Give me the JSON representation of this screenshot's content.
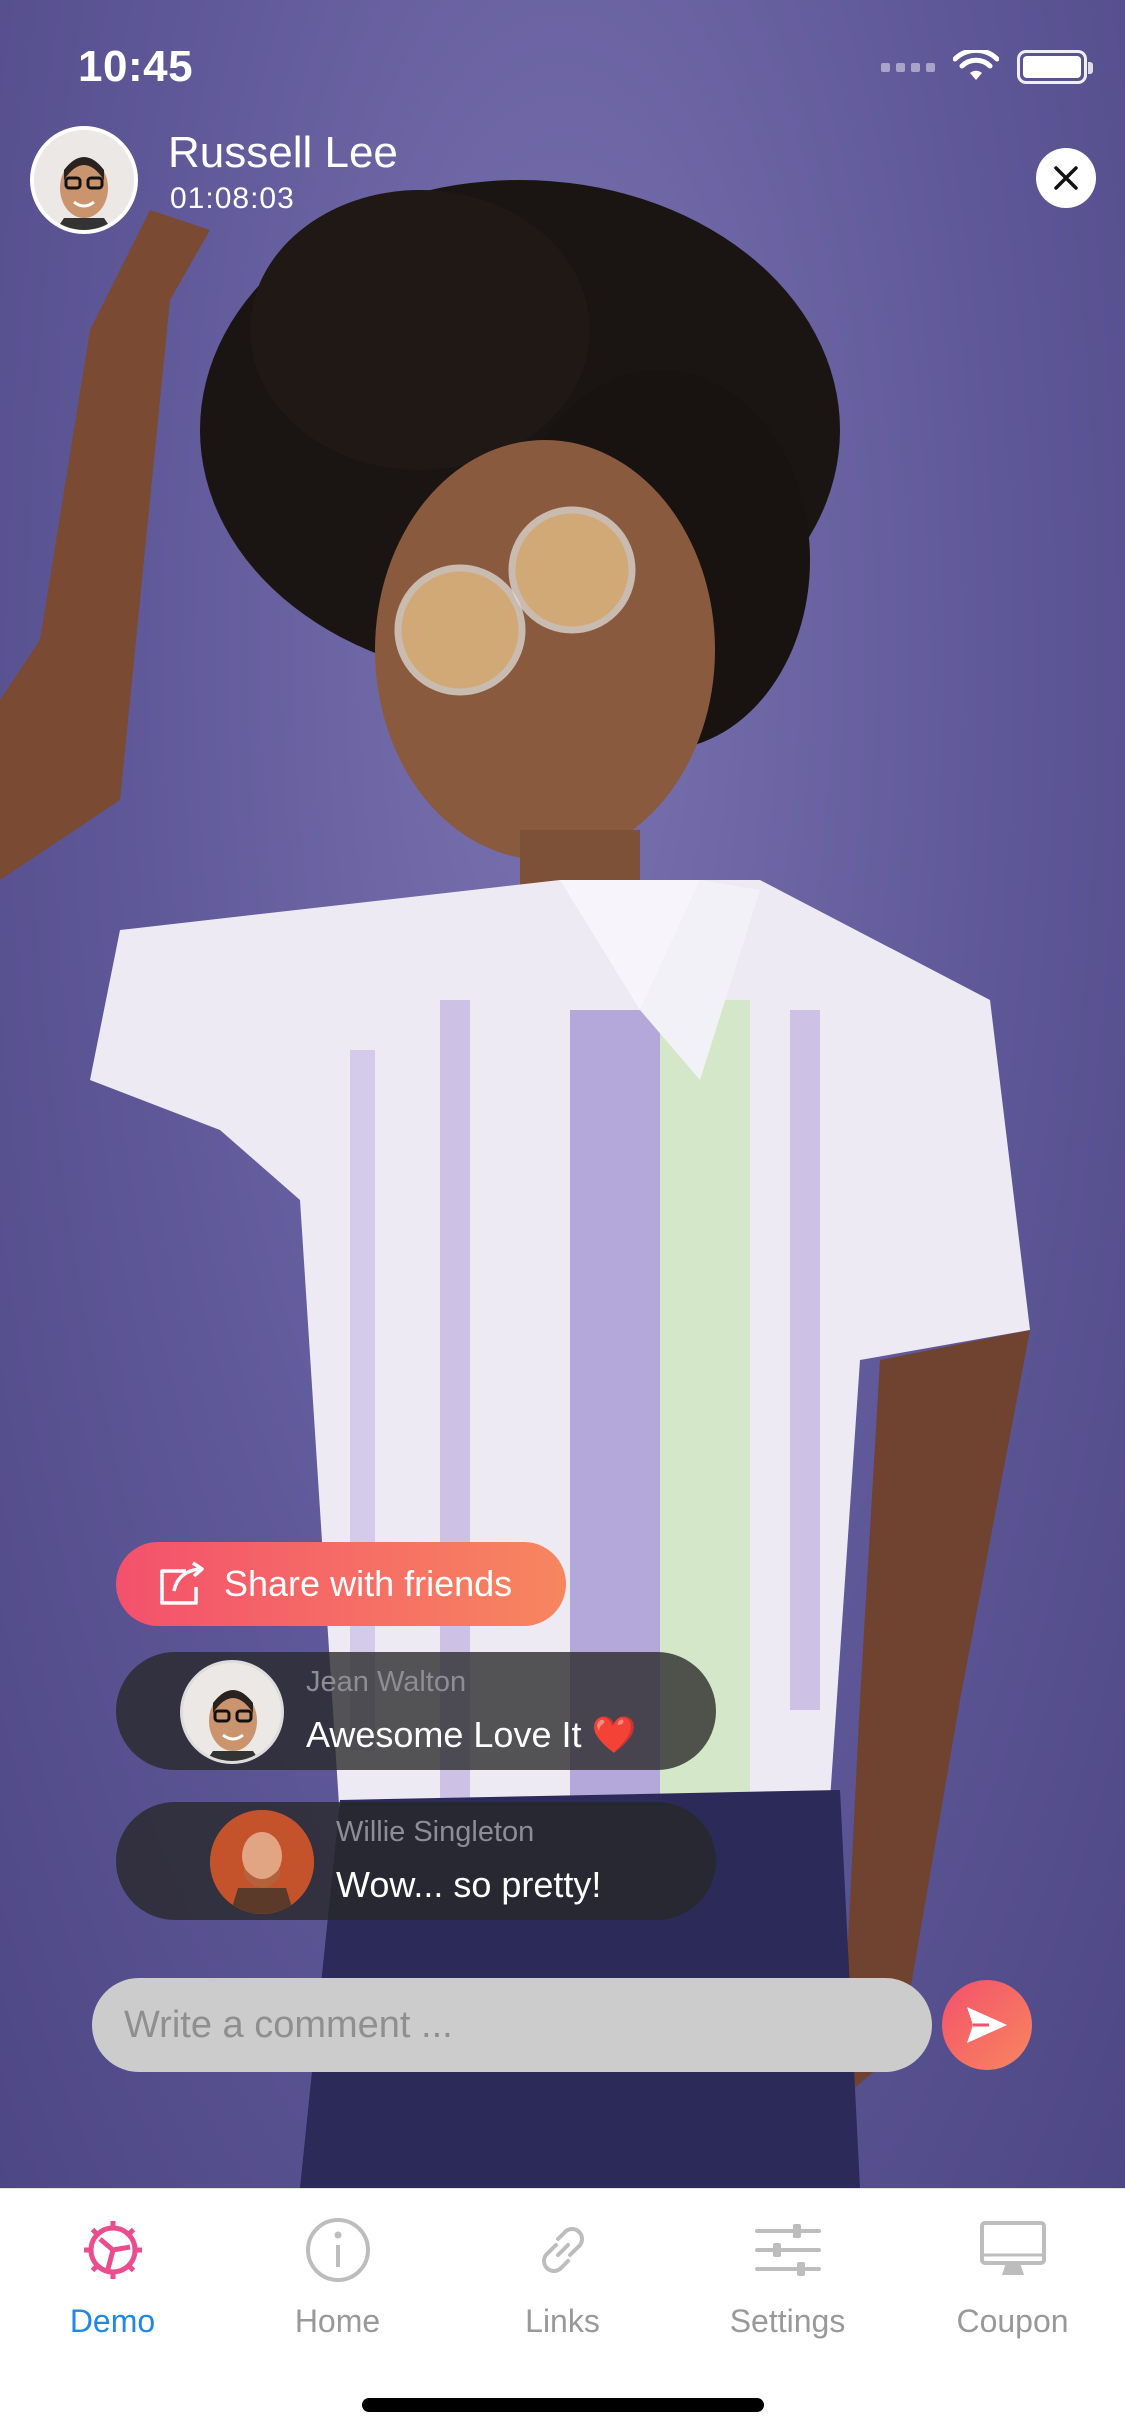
{
  "status_bar": {
    "time": "10:45"
  },
  "header": {
    "host_name": "Russell Lee",
    "timer": "01:08:03",
    "close_icon": "close-icon"
  },
  "share": {
    "label": "Share with friends",
    "icon": "share-icon"
  },
  "comments": [
    {
      "author": "Jean Walton",
      "message": "Awesome Love It ❤️"
    },
    {
      "author": "Willie Singleton",
      "message": "Wow... so pretty!"
    }
  ],
  "composer": {
    "placeholder": "Write a comment ...",
    "send_icon": "send-icon"
  },
  "tabbar": {
    "items": [
      {
        "label": "Demo",
        "icon": "gear-icon",
        "active": true
      },
      {
        "label": "Home",
        "icon": "info-icon",
        "active": false
      },
      {
        "label": "Links",
        "icon": "link-icon",
        "active": false
      },
      {
        "label": "Settings",
        "icon": "sliders-icon",
        "active": false
      },
      {
        "label": "Coupon",
        "icon": "monitor-icon",
        "active": false
      }
    ]
  },
  "colors": {
    "accent": "#f4516c",
    "accent_end": "#f7865f",
    "tab_active": "#1e88e5",
    "tab_inactive": "#999999",
    "background": "#5f5898"
  }
}
